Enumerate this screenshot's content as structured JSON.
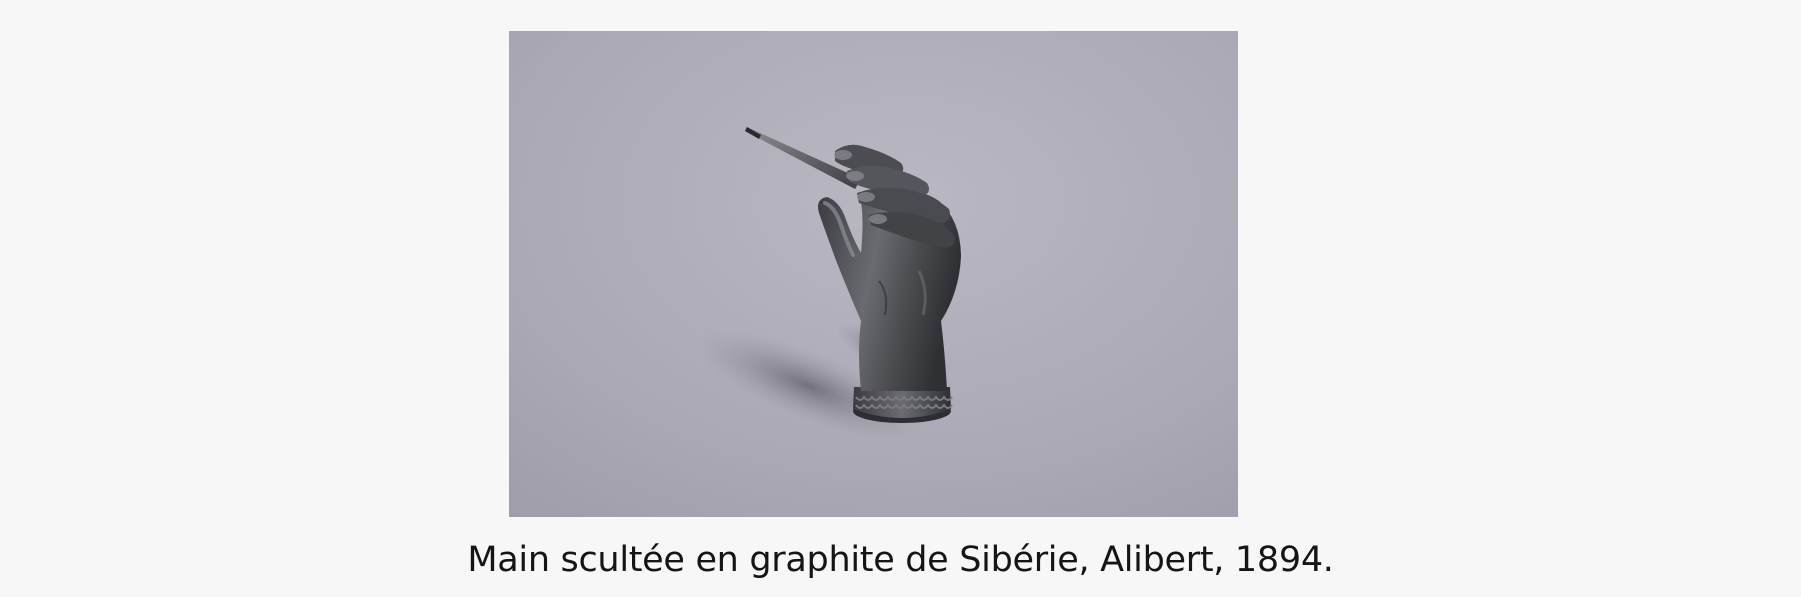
{
  "figure": {
    "image": {
      "subject": "graphite-hand-sculpture-holding-pencil",
      "background_color": "#aaa8b3",
      "object_color": "#4a4b4f"
    },
    "caption": "Main scultée en graphite de Sibérie, Alibert, 1894."
  }
}
